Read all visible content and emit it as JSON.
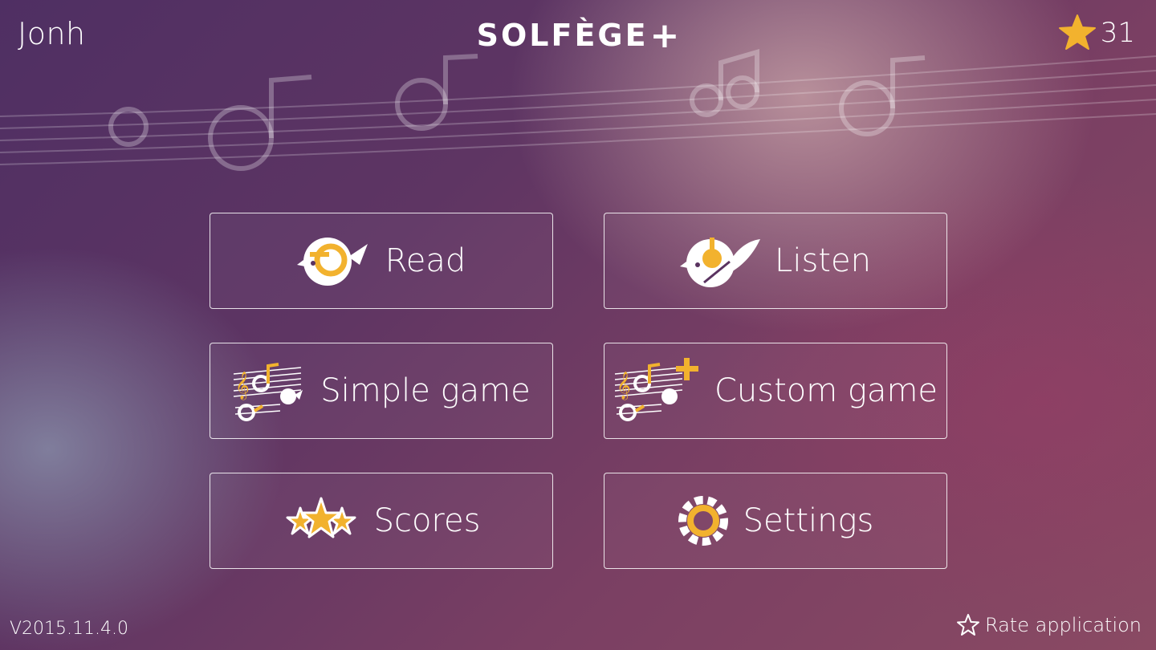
{
  "header": {
    "username": "Jonh",
    "app_title": "SOLFÈGE",
    "app_title_plus": "+",
    "stars": "31"
  },
  "menu": {
    "read": "Read",
    "listen": "Listen",
    "simple_game": "Simple game",
    "custom_game": "Custom game",
    "scores": "Scores",
    "settings": "Settings"
  },
  "footer": {
    "version": "V2015.11.4.0",
    "rate": "Rate application"
  },
  "colors": {
    "accent": "#f2b22e",
    "text": "#ffffff"
  }
}
